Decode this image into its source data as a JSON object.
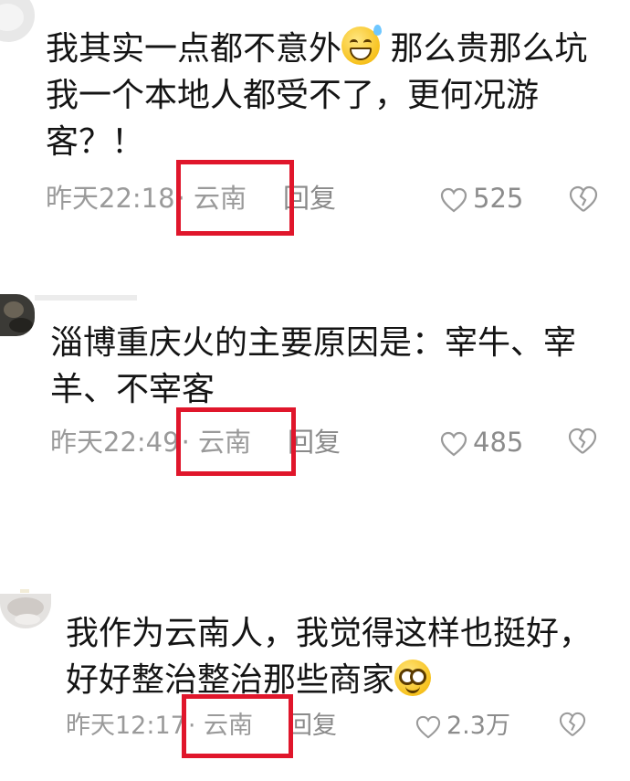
{
  "comments": [
    {
      "text_before_emoji": "我其实一点都不意外",
      "text_after_emoji": " 那么贵那么坑\n我一个本地人都受不了，更何况游\n客？！",
      "emoji": "sweat-smile-emoji",
      "time": "昨天22:18",
      "location": "· 云南",
      "reply": "回复",
      "likes": "525"
    },
    {
      "text_before_emoji": "淄博重庆火的主要原因是：宰牛、宰\n羊、不宰客",
      "text_after_emoji": "",
      "emoji": "",
      "time": "昨天22:49",
      "location": "· 云南",
      "reply": "回复",
      "likes": "485"
    },
    {
      "text_before_emoji": "我作为云南人，我觉得这样也挺好，\n好好整治整治那些商家",
      "text_after_emoji": "",
      "emoji": "flushed-smile-emoji",
      "time": "昨天12:17",
      "location": "· 云南",
      "reply": "回复",
      "likes": "2.3万"
    }
  ],
  "colors": {
    "highlight_box": "#e0162b",
    "meta_text": "#9a9a9a",
    "body_text": "#141414"
  },
  "icons": {
    "like": "heart-outline-icon",
    "dislike": "broken-heart-icon"
  }
}
